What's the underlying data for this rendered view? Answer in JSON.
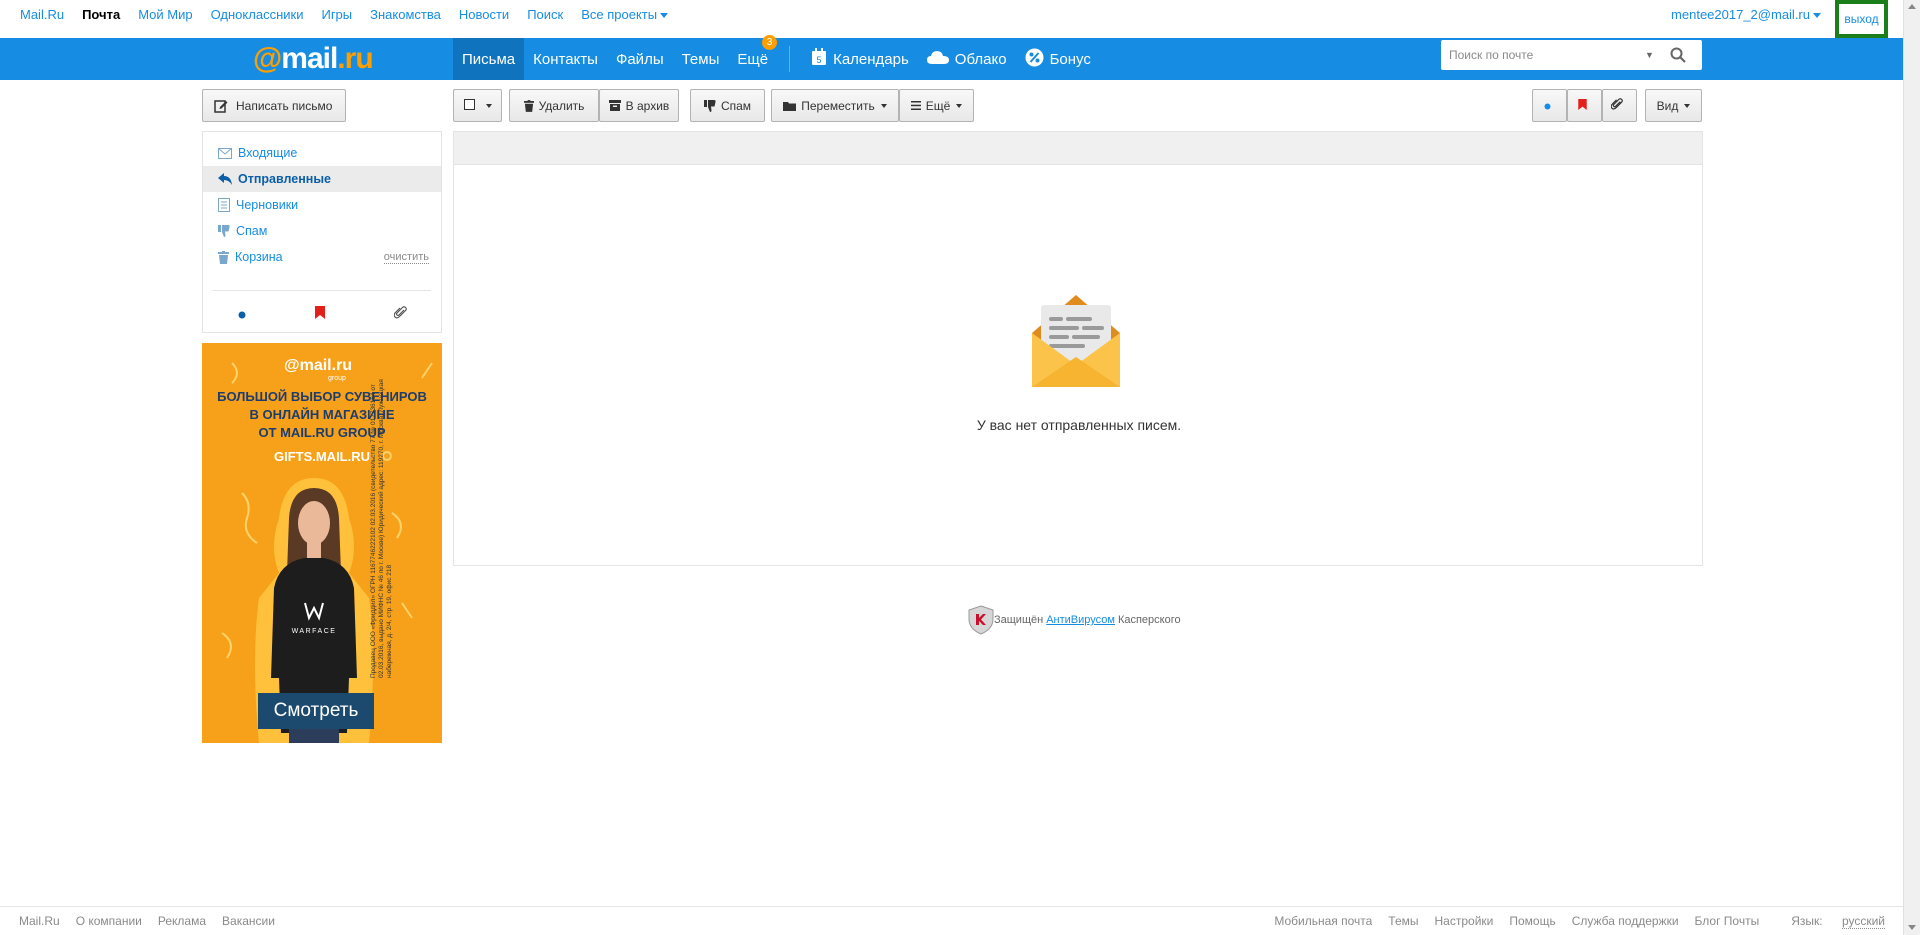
{
  "portal": {
    "links": [
      "Mail.Ru",
      "Почта",
      "Мой Мир",
      "Одноклассники",
      "Игры",
      "Знакомства",
      "Новости",
      "Поиск"
    ],
    "all_projects": "Все проекты",
    "user_email": "mentee2017_2@mail.ru",
    "logout": "выход"
  },
  "header": {
    "logo_at": "@",
    "logo_mail": "mail",
    "logo_dot": ".",
    "logo_ru": "ru",
    "nav": {
      "letters": "Письма",
      "contacts": "Контакты",
      "files": "Файлы",
      "themes": "Темы",
      "more": "Ещё",
      "more_badge": "3",
      "calendar": "Календарь",
      "calendar_day": "5",
      "cloud": "Облако",
      "bonus": "Бонус"
    },
    "search_placeholder": "Поиск по почте"
  },
  "sidebar": {
    "compose": "Написать письмо",
    "folders": {
      "inbox": "Входящие",
      "sent": "Отправленные",
      "drafts": "Черновики",
      "spam": "Спам",
      "trash": "Корзина"
    },
    "clean": "очистить"
  },
  "ad": {
    "logo": "@mail.ru",
    "group": "group",
    "line1": "БОЛЬШОЙ ВЫБОР СУВЕНИРОВ",
    "line2": "В  ОНЛАЙН МАГАЗИНЕ",
    "line3": "ОТ MAIL.RU GROUP",
    "site": "GIFTS.MAIL.RU",
    "shirt_brand": "WARFACE",
    "button": "Смотреть",
    "legal": "Продавец ООО «Фриддил» ОГРН 1167746222102 02.03.2016 (свидетельство 77 № 017736164 от 02.03.2016, выдано МИФНС № 46 по г. Москве) Юридический адрес: 119270, г. Москва, Лужнецкая набережная, д. 2/4, стр. 19, офис 218"
  },
  "toolbar": {
    "delete": "Удалить",
    "archive": "В архив",
    "spam": "Спам",
    "move": "Переместить",
    "more": "Ещё",
    "view": "Вид"
  },
  "main": {
    "empty_text": "У вас нет отправленных писем."
  },
  "kaspersky": {
    "prefix": "Защищён",
    "link": "АнтиВирусом",
    "suffix": "Касперского"
  },
  "footer": {
    "left": [
      "Mail.Ru",
      "О компании",
      "Реклама",
      "Вакансии"
    ],
    "right": [
      "Мобильная почта",
      "Темы",
      "Настройки",
      "Помощь",
      "Служба поддержки",
      "Блог Почты"
    ],
    "lang_label": "Язык:",
    "lang_value": "русский"
  },
  "colors": {
    "brand_blue": "#168de2",
    "brand_orange": "#ff9e00",
    "active_nav": "#0f74bd",
    "highlight_box": "#1a7f1a"
  }
}
